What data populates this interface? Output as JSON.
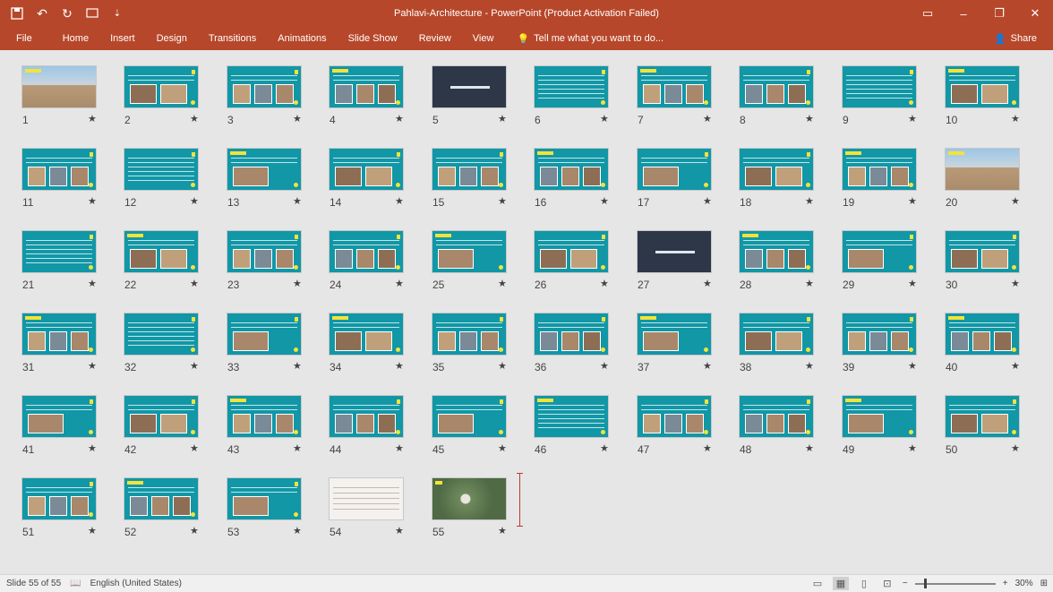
{
  "window": {
    "title": "Pahlavi-Architecture - PowerPoint (Product Activation Failed)"
  },
  "ribbon": {
    "tabs": [
      "File",
      "Home",
      "Insert",
      "Design",
      "Transitions",
      "Animations",
      "Slide Show",
      "Review",
      "View"
    ],
    "tell_me": "Tell me what you want to do...",
    "share": "Share"
  },
  "colors": {
    "accent": "#b7472a",
    "slide_teal": "#1197a6",
    "highlight_yellow": "#f4e33a"
  },
  "slides": [
    {
      "n": "1",
      "star": "★",
      "style": "photo"
    },
    {
      "n": "2",
      "star": "★",
      "style": "img"
    },
    {
      "n": "3",
      "star": "★",
      "style": "img"
    },
    {
      "n": "4",
      "star": "★",
      "style": "img"
    },
    {
      "n": "5",
      "star": "★",
      "style": "dark"
    },
    {
      "n": "6",
      "star": "★",
      "style": "text"
    },
    {
      "n": "7",
      "star": "★",
      "style": "img"
    },
    {
      "n": "8",
      "star": "★",
      "style": "img"
    },
    {
      "n": "9",
      "star": "★",
      "style": "text"
    },
    {
      "n": "10",
      "star": "★",
      "style": "img"
    },
    {
      "n": "11",
      "star": "★",
      "style": "img"
    },
    {
      "n": "12",
      "star": "★",
      "style": "text"
    },
    {
      "n": "13",
      "star": "★",
      "style": "img"
    },
    {
      "n": "14",
      "star": "★",
      "style": "img"
    },
    {
      "n": "15",
      "star": "★",
      "style": "img"
    },
    {
      "n": "16",
      "star": "★",
      "style": "img"
    },
    {
      "n": "17",
      "star": "★",
      "style": "img"
    },
    {
      "n": "18",
      "star": "★",
      "style": "img"
    },
    {
      "n": "19",
      "star": "★",
      "style": "img"
    },
    {
      "n": "20",
      "star": "★",
      "style": "photo"
    },
    {
      "n": "21",
      "star": "★",
      "style": "text"
    },
    {
      "n": "22",
      "star": "★",
      "style": "img"
    },
    {
      "n": "23",
      "star": "★",
      "style": "img"
    },
    {
      "n": "24",
      "star": "★",
      "style": "img"
    },
    {
      "n": "25",
      "star": "★",
      "style": "img"
    },
    {
      "n": "26",
      "star": "★",
      "style": "img"
    },
    {
      "n": "27",
      "star": "★",
      "style": "dark"
    },
    {
      "n": "28",
      "star": "★",
      "style": "img"
    },
    {
      "n": "29",
      "star": "★",
      "style": "img"
    },
    {
      "n": "30",
      "star": "★",
      "style": "img"
    },
    {
      "n": "31",
      "star": "★",
      "style": "img"
    },
    {
      "n": "32",
      "star": "★",
      "style": "text"
    },
    {
      "n": "33",
      "star": "★",
      "style": "img"
    },
    {
      "n": "34",
      "star": "★",
      "style": "img"
    },
    {
      "n": "35",
      "star": "★",
      "style": "img"
    },
    {
      "n": "36",
      "star": "★",
      "style": "img"
    },
    {
      "n": "37",
      "star": "★",
      "style": "img"
    },
    {
      "n": "38",
      "star": "★",
      "style": "img"
    },
    {
      "n": "39",
      "star": "★",
      "style": "img"
    },
    {
      "n": "40",
      "star": "★",
      "style": "img"
    },
    {
      "n": "41",
      "star": "★",
      "style": "img"
    },
    {
      "n": "42",
      "star": "★",
      "style": "img"
    },
    {
      "n": "43",
      "star": "★",
      "style": "img"
    },
    {
      "n": "44",
      "star": "★",
      "style": "img"
    },
    {
      "n": "45",
      "star": "★",
      "style": "img"
    },
    {
      "n": "46",
      "star": "★",
      "style": "text"
    },
    {
      "n": "47",
      "star": "★",
      "style": "img"
    },
    {
      "n": "48",
      "star": "★",
      "style": "img"
    },
    {
      "n": "49",
      "star": "★",
      "style": "img"
    },
    {
      "n": "50",
      "star": "★",
      "style": "img"
    },
    {
      "n": "51",
      "star": "★",
      "style": "img"
    },
    {
      "n": "52",
      "star": "★",
      "style": "img"
    },
    {
      "n": "53",
      "star": "★",
      "style": "img"
    },
    {
      "n": "54",
      "star": "★",
      "style": "light"
    },
    {
      "n": "55",
      "star": "★",
      "style": "pond"
    }
  ],
  "status": {
    "slide_info": "Slide 55 of 55",
    "language": "English (United States)",
    "zoom": "30%",
    "zoom_minus": "−",
    "zoom_plus": "+"
  }
}
